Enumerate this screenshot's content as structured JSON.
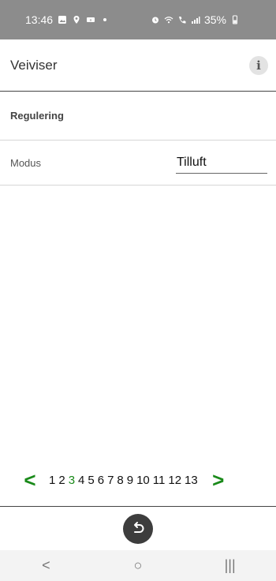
{
  "status_bar": {
    "time": "13:46",
    "battery": "35%",
    "icons_left": [
      "gallery-icon",
      "location-icon",
      "sync-icon",
      "dot-icon"
    ],
    "icons_right": [
      "alarm-icon",
      "wifi-icon",
      "call-signal-icon",
      "signal-bars-icon",
      "battery-icon"
    ]
  },
  "header": {
    "title": "Veiviser",
    "info_icon": "i"
  },
  "section": {
    "title": "Regulering"
  },
  "field": {
    "label": "Modus",
    "value": "Tilluft"
  },
  "pager": {
    "prev": "<",
    "next": ">",
    "pages": [
      "1",
      "2",
      "3",
      "4",
      "5",
      "6",
      "7",
      "8",
      "9",
      "10",
      "11",
      "12",
      "13"
    ],
    "current": "3"
  },
  "nav": {
    "back": "<",
    "home": "○",
    "recents": "|||"
  },
  "colors": {
    "accent_green": "#1a8a1a",
    "status_bar": "#8c8c8c",
    "back_button": "#3d3d3d"
  }
}
